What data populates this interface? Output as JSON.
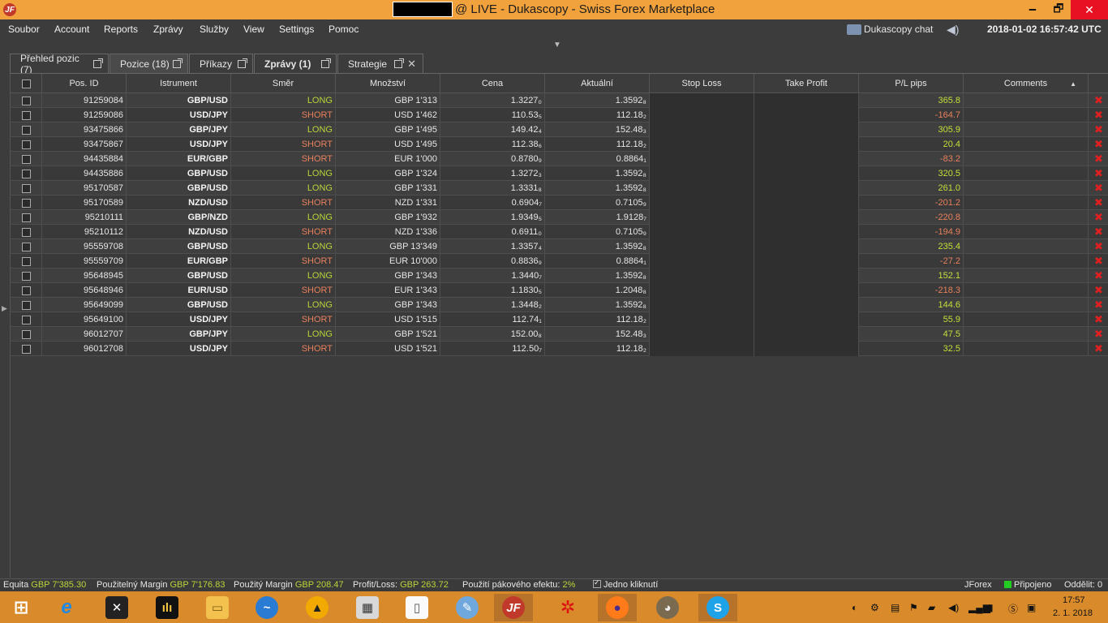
{
  "window": {
    "title": "@ LIVE - Dukascopy - Swiss Forex Marketplace",
    "logo": "JF",
    "minimize": "🗕",
    "maximize": "🗗",
    "close": "✕"
  },
  "menu": [
    "Soubor",
    "Account",
    "Reports",
    "Zprávy",
    "Služby",
    "View",
    "Settings",
    "Pomoc"
  ],
  "chat_label": "Dukascopy chat",
  "clock": "2018-01-02 16:57:42 UTC",
  "tabs": [
    {
      "label": "Přehled pozic (7)"
    },
    {
      "label": "Pozice (18)"
    },
    {
      "label": "Příkazy"
    },
    {
      "label": "Zprávy (1)"
    },
    {
      "label": "Strategie"
    }
  ],
  "columns": [
    "Pos. ID",
    "Istrument",
    "Směr",
    "Množství",
    "Cena",
    "Aktuální",
    "Stop Loss",
    "Take Profit",
    "P/L pips",
    "Comments"
  ],
  "rows": [
    {
      "id": "91259084",
      "instrument": "GBP/USD",
      "direction": "LONG",
      "amount": "GBP 1'313",
      "price": "1.3227₀",
      "current": "1.3592₈",
      "pl": "365.8"
    },
    {
      "id": "91259086",
      "instrument": "USD/JPY",
      "direction": "SHORT",
      "amount": "USD 1'462",
      "price": "110.53₅",
      "current": "112.18₂",
      "pl": "-164.7"
    },
    {
      "id": "93475866",
      "instrument": "GBP/JPY",
      "direction": "LONG",
      "amount": "GBP 1'495",
      "price": "149.42₄",
      "current": "152.48₃",
      "pl": "305.9"
    },
    {
      "id": "93475867",
      "instrument": "USD/JPY",
      "direction": "SHORT",
      "amount": "USD 1'495",
      "price": "112.38₆",
      "current": "112.18₂",
      "pl": "20.4"
    },
    {
      "id": "94435884",
      "instrument": "EUR/GBP",
      "direction": "SHORT",
      "amount": "EUR 1'000",
      "price": "0.8780₉",
      "current": "0.8864₁",
      "pl": "-83.2"
    },
    {
      "id": "94435886",
      "instrument": "GBP/USD",
      "direction": "LONG",
      "amount": "GBP 1'324",
      "price": "1.3272₃",
      "current": "1.3592₈",
      "pl": "320.5"
    },
    {
      "id": "95170587",
      "instrument": "GBP/USD",
      "direction": "LONG",
      "amount": "GBP 1'331",
      "price": "1.3331₈",
      "current": "1.3592₈",
      "pl": "261.0"
    },
    {
      "id": "95170589",
      "instrument": "NZD/USD",
      "direction": "SHORT",
      "amount": "NZD 1'331",
      "price": "0.6904₇",
      "current": "0.7105₉",
      "pl": "-201.2"
    },
    {
      "id": "95210111",
      "instrument": "GBP/NZD",
      "direction": "LONG",
      "amount": "GBP 1'932",
      "price": "1.9349₅",
      "current": "1.9128₇",
      "pl": "-220.8"
    },
    {
      "id": "95210112",
      "instrument": "NZD/USD",
      "direction": "SHORT",
      "amount": "NZD 1'336",
      "price": "0.6911₀",
      "current": "0.7105₉",
      "pl": "-194.9"
    },
    {
      "id": "95559708",
      "instrument": "GBP/USD",
      "direction": "LONG",
      "amount": "GBP 13'349",
      "price": "1.3357₄",
      "current": "1.3592₈",
      "pl": "235.4"
    },
    {
      "id": "95559709",
      "instrument": "EUR/GBP",
      "direction": "SHORT",
      "amount": "EUR 10'000",
      "price": "0.8836₉",
      "current": "0.8864₁",
      "pl": "-27.2"
    },
    {
      "id": "95648945",
      "instrument": "GBP/USD",
      "direction": "LONG",
      "amount": "GBP 1'343",
      "price": "1.3440₇",
      "current": "1.3592₈",
      "pl": "152.1"
    },
    {
      "id": "95648946",
      "instrument": "EUR/USD",
      "direction": "SHORT",
      "amount": "EUR 1'343",
      "price": "1.1830₅",
      "current": "1.2048₈",
      "pl": "-218.3"
    },
    {
      "id": "95649099",
      "instrument": "GBP/USD",
      "direction": "LONG",
      "amount": "GBP 1'343",
      "price": "1.3448₂",
      "current": "1.3592₈",
      "pl": "144.6"
    },
    {
      "id": "95649100",
      "instrument": "USD/JPY",
      "direction": "SHORT",
      "amount": "USD 1'515",
      "price": "112.74₁",
      "current": "112.18₂",
      "pl": "55.9"
    },
    {
      "id": "96012707",
      "instrument": "GBP/JPY",
      "direction": "LONG",
      "amount": "GBP 1'521",
      "price": "152.00₈",
      "current": "152.48₃",
      "pl": "47.5"
    },
    {
      "id": "96012708",
      "instrument": "USD/JPY",
      "direction": "SHORT",
      "amount": "USD 1'521",
      "price": "112.50₇",
      "current": "112.18₂",
      "pl": "32.5"
    }
  ],
  "status": {
    "equity_label": "Equita",
    "equity_value": "GBP 7'385.30",
    "usable_margin_label": "Použitelný Margin",
    "usable_margin_value": "GBP 7'176.83",
    "used_margin_label": "Použitý Margin",
    "used_margin_value": "GBP 208.47",
    "pl_label": "Profit/Loss:",
    "pl_value": "GBP 263.72",
    "leverage_label": "Použití pákového efektu:",
    "leverage_value": "2%",
    "one_click_label": "Jedno kliknutí",
    "platform": "JForex",
    "connection": "Připojeno",
    "delay": "Oddělit: 0"
  },
  "taskbar": {
    "time": "17:57",
    "date": "2. 1. 2018",
    "apps": [
      "windows-start",
      "internet-explorer",
      "xtb",
      "mt4",
      "file-explorer",
      "thunderbird",
      "signal-app",
      "calculator",
      "notepad",
      "paint",
      "jforex",
      "red-app",
      "firefox",
      "gimp",
      "skype"
    ]
  },
  "colors": {
    "long": "#b8d53a",
    "short": "#e8805c",
    "delete": "#e02020",
    "titlebar": "#f2a23c",
    "taskbar": "#d98b2b"
  }
}
